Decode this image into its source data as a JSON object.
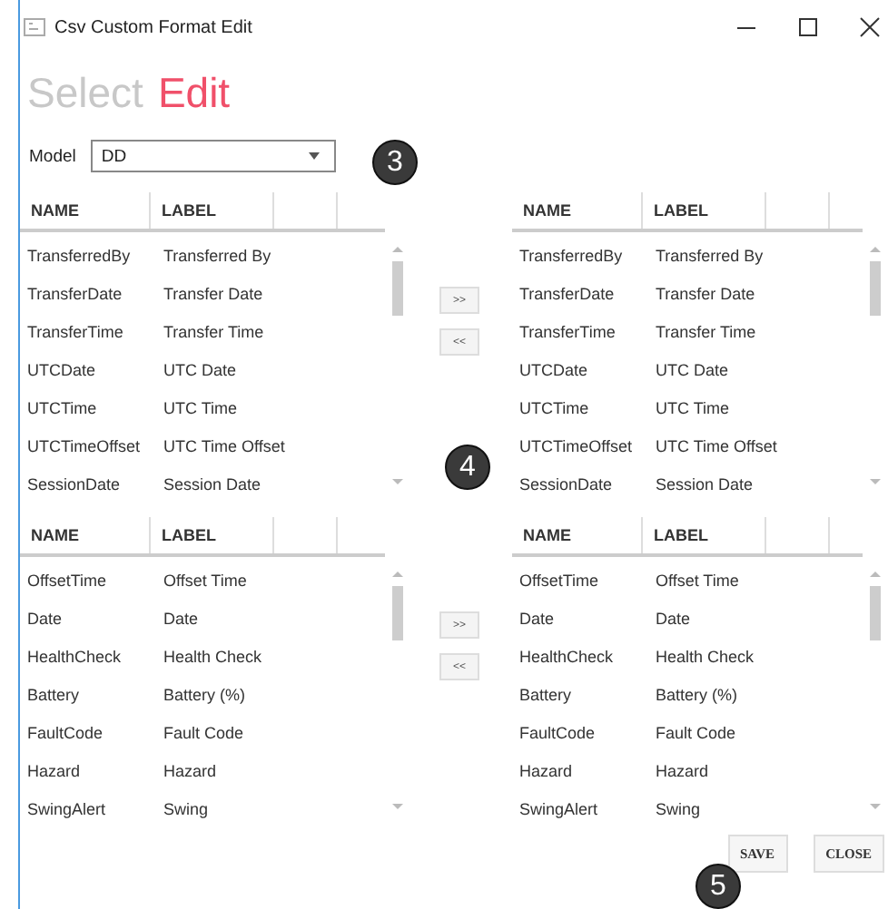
{
  "window": {
    "title": "Csv Custom Format Edit"
  },
  "steps": [
    {
      "label": "Select",
      "selected": false
    },
    {
      "label": "Edit",
      "selected": true
    }
  ],
  "model": {
    "label": "Model",
    "value": "DD"
  },
  "sections": [
    {
      "available": {
        "columns": [
          "NAME",
          "LABEL"
        ],
        "rows": [
          [
            "TransferredBy",
            "Transferred By"
          ],
          [
            "TransferDate",
            "Transfer Date"
          ],
          [
            "TransferTime",
            "Transfer Time"
          ],
          [
            "UTCDate",
            "UTC Date"
          ],
          [
            "UTCTime",
            "UTC Time"
          ],
          [
            "UTCTimeOffset",
            "UTC Time Offset"
          ],
          [
            "SessionDate",
            "Session Date"
          ]
        ]
      },
      "buttons": [
        ">>",
        "<<"
      ],
      "selected": {
        "columns": [
          "NAME",
          "LABEL"
        ],
        "rows": [
          [
            "TransferredBy",
            "Transferred By"
          ],
          [
            "TransferDate",
            "Transfer Date"
          ],
          [
            "TransferTime",
            "Transfer Time"
          ],
          [
            "UTCDate",
            "UTC Date"
          ],
          [
            "UTCTime",
            "UTC Time"
          ],
          [
            "UTCTimeOffset",
            "UTC Time Offset"
          ],
          [
            "SessionDate",
            "Session Date"
          ]
        ]
      }
    },
    {
      "available": {
        "columns": [
          "NAME",
          "LABEL"
        ],
        "rows": [
          [
            "OffsetTime",
            "Offset Time"
          ],
          [
            "Date",
            "Date"
          ],
          [
            "HealthCheck",
            "Health Check"
          ],
          [
            "Battery",
            "Battery (%)"
          ],
          [
            "FaultCode",
            "Fault Code"
          ],
          [
            "Hazard",
            "Hazard"
          ],
          [
            "SwingAlert",
            "Swing"
          ]
        ]
      },
      "buttons": [
        ">>",
        "<<"
      ],
      "selected": {
        "columns": [
          "NAME",
          "LABEL"
        ],
        "rows": [
          [
            "OffsetTime",
            "Offset Time"
          ],
          [
            "Date",
            "Date"
          ],
          [
            "HealthCheck",
            "Health Check"
          ],
          [
            "Battery",
            "Battery (%)"
          ],
          [
            "FaultCode",
            "Fault Code"
          ],
          [
            "Hazard",
            "Hazard"
          ],
          [
            "SwingAlert",
            "Swing"
          ]
        ]
      }
    }
  ],
  "actions": [
    "SAVE",
    "CLOSE"
  ],
  "callouts": [
    "3",
    "4",
    "5"
  ]
}
